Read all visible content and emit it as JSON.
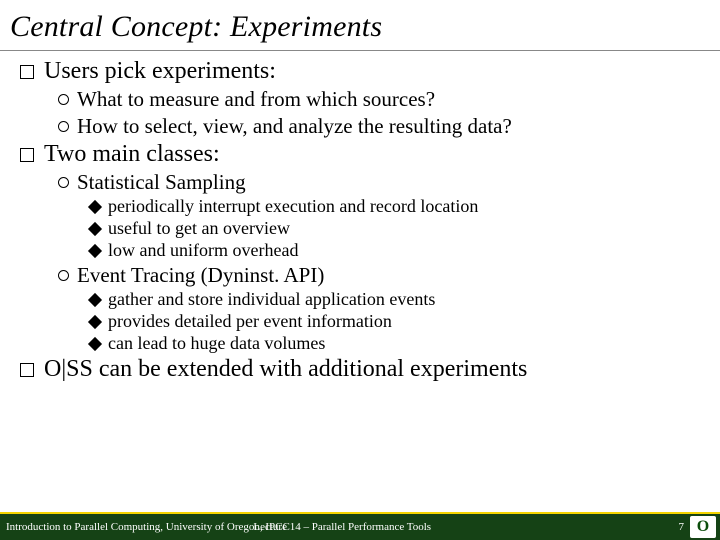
{
  "title": "Central Concept: Experiments",
  "b1": {
    "a": "Users pick experiments:",
    "a1": "What to measure and from which sources?",
    "a2": "How to select, view, and analyze the resulting data?",
    "b": "Two main classes:",
    "b1": "Statistical Sampling",
    "b1a": "periodically interrupt execution and record location",
    "b1b": "useful to get an overview",
    "b1c": "low and uniform overhead",
    "b2": "Event Tracing (Dyninst. API)",
    "b2a": "gather and store individual application events",
    "b2b": "provides detailed per event information",
    "b2c": "can lead to huge data volumes",
    "c": "O|SS can be extended with additional experiments"
  },
  "footer": {
    "left": "Introduction to Parallel Computing, University of Oregon, IPCC",
    "center": "Lecture 14 – Parallel Performance Tools",
    "page": "7",
    "logo": "O"
  }
}
